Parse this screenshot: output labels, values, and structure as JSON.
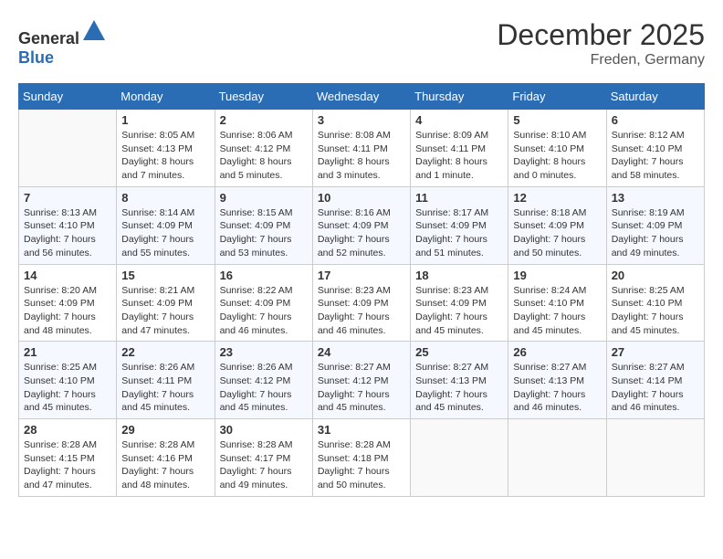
{
  "header": {
    "logo_general": "General",
    "logo_blue": "Blue",
    "month_year": "December 2025",
    "location": "Freden, Germany"
  },
  "columns": [
    "Sunday",
    "Monday",
    "Tuesday",
    "Wednesday",
    "Thursday",
    "Friday",
    "Saturday"
  ],
  "weeks": [
    [
      {
        "day": "",
        "info": ""
      },
      {
        "day": "1",
        "info": "Sunrise: 8:05 AM\nSunset: 4:13 PM\nDaylight: 8 hours\nand 7 minutes."
      },
      {
        "day": "2",
        "info": "Sunrise: 8:06 AM\nSunset: 4:12 PM\nDaylight: 8 hours\nand 5 minutes."
      },
      {
        "day": "3",
        "info": "Sunrise: 8:08 AM\nSunset: 4:11 PM\nDaylight: 8 hours\nand 3 minutes."
      },
      {
        "day": "4",
        "info": "Sunrise: 8:09 AM\nSunset: 4:11 PM\nDaylight: 8 hours\nand 1 minute."
      },
      {
        "day": "5",
        "info": "Sunrise: 8:10 AM\nSunset: 4:10 PM\nDaylight: 8 hours\nand 0 minutes."
      },
      {
        "day": "6",
        "info": "Sunrise: 8:12 AM\nSunset: 4:10 PM\nDaylight: 7 hours\nand 58 minutes."
      }
    ],
    [
      {
        "day": "7",
        "info": "Sunrise: 8:13 AM\nSunset: 4:10 PM\nDaylight: 7 hours\nand 56 minutes."
      },
      {
        "day": "8",
        "info": "Sunrise: 8:14 AM\nSunset: 4:09 PM\nDaylight: 7 hours\nand 55 minutes."
      },
      {
        "day": "9",
        "info": "Sunrise: 8:15 AM\nSunset: 4:09 PM\nDaylight: 7 hours\nand 53 minutes."
      },
      {
        "day": "10",
        "info": "Sunrise: 8:16 AM\nSunset: 4:09 PM\nDaylight: 7 hours\nand 52 minutes."
      },
      {
        "day": "11",
        "info": "Sunrise: 8:17 AM\nSunset: 4:09 PM\nDaylight: 7 hours\nand 51 minutes."
      },
      {
        "day": "12",
        "info": "Sunrise: 8:18 AM\nSunset: 4:09 PM\nDaylight: 7 hours\nand 50 minutes."
      },
      {
        "day": "13",
        "info": "Sunrise: 8:19 AM\nSunset: 4:09 PM\nDaylight: 7 hours\nand 49 minutes."
      }
    ],
    [
      {
        "day": "14",
        "info": "Sunrise: 8:20 AM\nSunset: 4:09 PM\nDaylight: 7 hours\nand 48 minutes."
      },
      {
        "day": "15",
        "info": "Sunrise: 8:21 AM\nSunset: 4:09 PM\nDaylight: 7 hours\nand 47 minutes."
      },
      {
        "day": "16",
        "info": "Sunrise: 8:22 AM\nSunset: 4:09 PM\nDaylight: 7 hours\nand 46 minutes."
      },
      {
        "day": "17",
        "info": "Sunrise: 8:23 AM\nSunset: 4:09 PM\nDaylight: 7 hours\nand 46 minutes."
      },
      {
        "day": "18",
        "info": "Sunrise: 8:23 AM\nSunset: 4:09 PM\nDaylight: 7 hours\nand 45 minutes."
      },
      {
        "day": "19",
        "info": "Sunrise: 8:24 AM\nSunset: 4:10 PM\nDaylight: 7 hours\nand 45 minutes."
      },
      {
        "day": "20",
        "info": "Sunrise: 8:25 AM\nSunset: 4:10 PM\nDaylight: 7 hours\nand 45 minutes."
      }
    ],
    [
      {
        "day": "21",
        "info": "Sunrise: 8:25 AM\nSunset: 4:10 PM\nDaylight: 7 hours\nand 45 minutes."
      },
      {
        "day": "22",
        "info": "Sunrise: 8:26 AM\nSunset: 4:11 PM\nDaylight: 7 hours\nand 45 minutes."
      },
      {
        "day": "23",
        "info": "Sunrise: 8:26 AM\nSunset: 4:12 PM\nDaylight: 7 hours\nand 45 minutes."
      },
      {
        "day": "24",
        "info": "Sunrise: 8:27 AM\nSunset: 4:12 PM\nDaylight: 7 hours\nand 45 minutes."
      },
      {
        "day": "25",
        "info": "Sunrise: 8:27 AM\nSunset: 4:13 PM\nDaylight: 7 hours\nand 45 minutes."
      },
      {
        "day": "26",
        "info": "Sunrise: 8:27 AM\nSunset: 4:13 PM\nDaylight: 7 hours\nand 46 minutes."
      },
      {
        "day": "27",
        "info": "Sunrise: 8:27 AM\nSunset: 4:14 PM\nDaylight: 7 hours\nand 46 minutes."
      }
    ],
    [
      {
        "day": "28",
        "info": "Sunrise: 8:28 AM\nSunset: 4:15 PM\nDaylight: 7 hours\nand 47 minutes."
      },
      {
        "day": "29",
        "info": "Sunrise: 8:28 AM\nSunset: 4:16 PM\nDaylight: 7 hours\nand 48 minutes."
      },
      {
        "day": "30",
        "info": "Sunrise: 8:28 AM\nSunset: 4:17 PM\nDaylight: 7 hours\nand 49 minutes."
      },
      {
        "day": "31",
        "info": "Sunrise: 8:28 AM\nSunset: 4:18 PM\nDaylight: 7 hours\nand 50 minutes."
      },
      {
        "day": "",
        "info": ""
      },
      {
        "day": "",
        "info": ""
      },
      {
        "day": "",
        "info": ""
      }
    ]
  ]
}
